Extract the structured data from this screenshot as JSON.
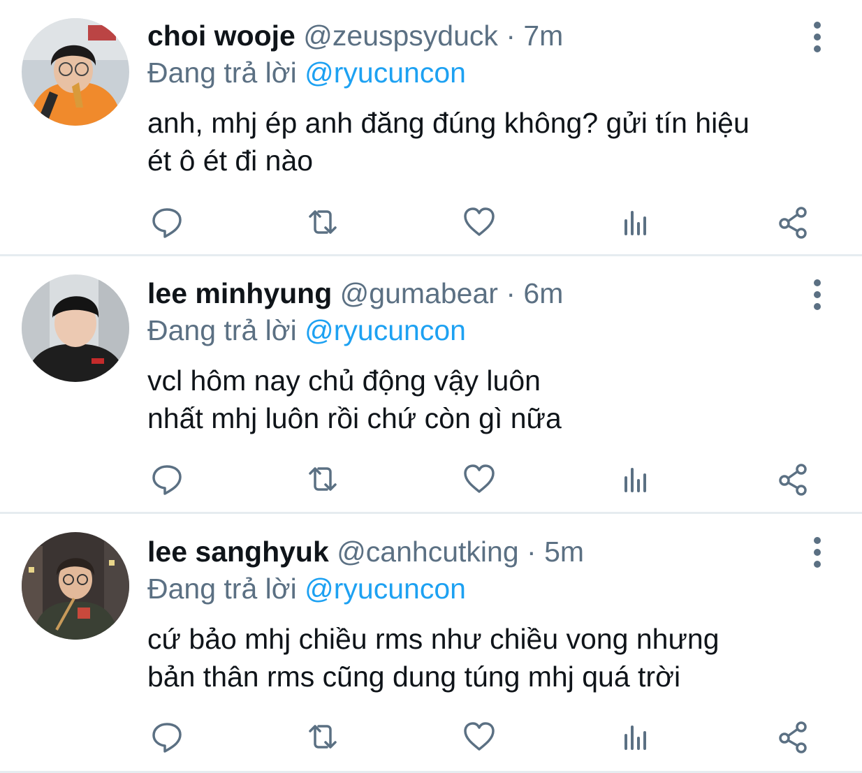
{
  "tweets": [
    {
      "name": "choi wooje",
      "handle": "@zeuspsyduck",
      "separator": "·",
      "time": "7m",
      "reply_prefix": "Đang trả lời",
      "reply_to": "@ryucuncon",
      "lines": [
        "anh, mhj ép anh đăng đúng không? gửi tín hiệu",
        "ét ô ét đi nào"
      ],
      "avatar_colors": {
        "bg": "#c9d0d6",
        "hair": "#1c1a1a",
        "skin": "#e8c1a4",
        "cloth": "#f08a2c"
      }
    },
    {
      "name": "lee minhyung",
      "handle": "@gumabear",
      "separator": "·",
      "time": "6m",
      "reply_prefix": "Đang trả lời",
      "reply_to": "@ryucuncon",
      "lines": [
        "vcl hôm nay chủ động vậy luôn",
        "nhất mhj luôn rồi chứ còn gì nữa"
      ],
      "avatar_colors": {
        "bg": "#d9dde0",
        "hair": "#141414",
        "skin": "#ecc9b2",
        "cloth": "#1e1e1e"
      }
    },
    {
      "name": "lee sanghyuk",
      "handle": "@canhcutking",
      "separator": "·",
      "time": "5m",
      "reply_prefix": "Đang trả lời",
      "reply_to": "@ryucuncon",
      "lines": [
        "cứ bảo mhj chiều rms như chiều vong nhưng",
        "bản thân rms cũng dung túng mhj quá trời"
      ],
      "avatar_colors": {
        "bg": "#3b3432",
        "hair": "#2a221e",
        "skin": "#e2b99a",
        "cloth": "#3a4034"
      }
    }
  ],
  "icons": {
    "reply": "reply-icon",
    "retweet": "retweet-icon",
    "like": "like-icon",
    "analytics": "analytics-icon",
    "share": "share-icon",
    "more": "more-icon"
  },
  "colors": {
    "text_primary": "#0f1419",
    "text_secondary": "#5b7083",
    "mention": "#1da1f2",
    "icon": "#5b7083",
    "divider": "#e6ecf0"
  }
}
